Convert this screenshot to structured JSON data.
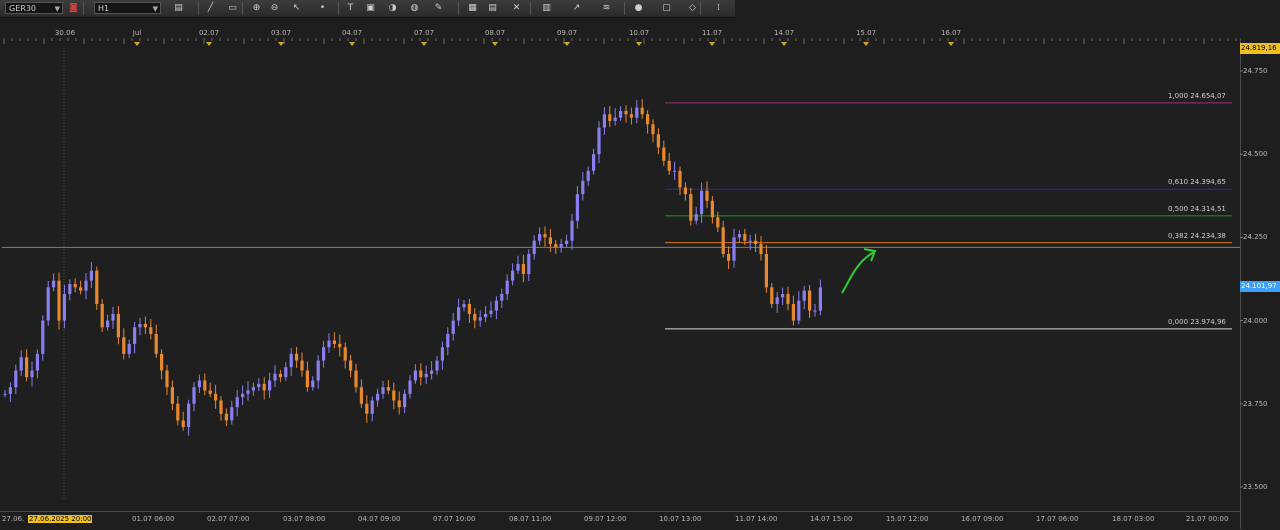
{
  "toolbar": {
    "symbol": "GER30",
    "timeframe": "H1",
    "icons": [
      "chart-type-icon",
      "line-tool-icon",
      "rectangle-tool-icon",
      "zoom-in-icon",
      "zoom-out-icon",
      "cursor-icon",
      "dot-icon",
      "text-tool-icon",
      "note-icon",
      "palette-icon",
      "globe-icon",
      "pencil-icon",
      "screenshot-icon",
      "template-icon",
      "crosshair-icon",
      "grid-icon",
      "trend-icon",
      "fib-icon",
      "circle-icon",
      "window-icon",
      "eraser-icon",
      "more-icon"
    ]
  },
  "top_dates": [
    "30.06",
    "Jul",
    "02.07",
    "03.07",
    "04.07",
    "07.07",
    "08.07",
    "09.07",
    "10.07",
    "11.07",
    "14.07",
    "15.07",
    "16.07"
  ],
  "bottom_dates": [
    "27.06.",
    "27.06.2025 20:00",
    "01.07 06:00",
    "02.07 07:00",
    "03.07 08:00",
    "04.07 09:00",
    "07.07 10:00",
    "08.07 11:00",
    "09.07 12:00",
    "10.07 13:00",
    "11.07 14:00",
    "14.07 15:00",
    "15.07 12:00",
    "16.07 09:00",
    "17.07 06:00",
    "18.07 03:00",
    "21.07 00:00"
  ],
  "price_axis": {
    "labels": [
      "24.750",
      "24.500",
      "24.250",
      "24.000",
      "23.750",
      "23.500"
    ],
    "top_badge": "24.819,16",
    "current_badge": "24.101,97"
  },
  "fibonacci": [
    {
      "label": "1,000 24.654,07",
      "color": "#a0307a"
    },
    {
      "label": "0,610 24.394,65",
      "color": "#2a2aa8"
    },
    {
      "label": "0,500 24.314,51",
      "color": "#1f9a1f"
    },
    {
      "label": "0,382 24.234,38",
      "color": "#d5771c"
    },
    {
      "label": "0,000 23.974,96",
      "color": "#d8d8d8"
    }
  ],
  "chart_data": {
    "type": "candlestick",
    "symbol": "GER30",
    "timeframe": "H1",
    "ylim": [
      23450,
      24820
    ],
    "up_color": "#8a7ff0",
    "down_color": "#e8892e",
    "horizontal_level": 24220,
    "start": 23780,
    "closes": [
      23780,
      23800,
      23850,
      23890,
      23830,
      23850,
      23900,
      24000,
      24100,
      24120,
      24000,
      24080,
      24110,
      24100,
      24090,
      24120,
      24150,
      24050,
      23980,
      24000,
      24020,
      23950,
      23900,
      23930,
      23980,
      23990,
      23980,
      23960,
      23900,
      23850,
      23800,
      23750,
      23700,
      23680,
      23750,
      23800,
      23820,
      23790,
      23780,
      23760,
      23720,
      23700,
      23740,
      23770,
      23780,
      23790,
      23800,
      23810,
      23790,
      23820,
      23840,
      23830,
      23860,
      23900,
      23880,
      23850,
      23800,
      23820,
      23880,
      23920,
      23940,
      23930,
      23920,
      23880,
      23850,
      23800,
      23750,
      23720,
      23760,
      23780,
      23800,
      23790,
      23760,
      23740,
      23780,
      23820,
      23850,
      23830,
      23840,
      23850,
      23880,
      23920,
      23960,
      24000,
      24040,
      24050,
      24020,
      24000,
      24010,
      24020,
      24030,
      24060,
      24080,
      24120,
      24150,
      24170,
      24140,
      24200,
      24240,
      24260,
      24250,
      24230,
      24220,
      24230,
      24240,
      24300,
      24380,
      24420,
      24450,
      24500,
      24580,
      24620,
      24600,
      24610,
      24630,
      24620,
      24610,
      24640,
      24620,
      24590,
      24560,
      24520,
      24480,
      24450,
      24450,
      24400,
      24380,
      24300,
      24320,
      24390,
      24360,
      24310,
      24280,
      24200,
      24180,
      24250,
      24260,
      24240,
      24240,
      24230,
      24200,
      24100,
      24050,
      24070,
      24080,
      24050,
      24000,
      24060,
      24090,
      24030,
      24030,
      24100
    ]
  }
}
